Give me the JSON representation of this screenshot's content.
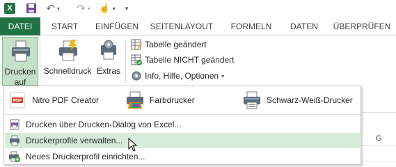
{
  "quick_access": {
    "app_icon_letter": "X"
  },
  "tabs": [
    {
      "label": "DATEI"
    },
    {
      "label": "START"
    },
    {
      "label": "EINFÜGEN"
    },
    {
      "label": "SEITENLAYOUT"
    },
    {
      "label": "FORMELN"
    },
    {
      "label": "DATEN"
    },
    {
      "label": "ÜBERPRÜFEN"
    }
  ],
  "ribbon": {
    "drucken": {
      "line1": "Drucken",
      "line2": "auf"
    },
    "schnelldruck": {
      "label": "Schnelldruck"
    },
    "extras": {
      "label": "Extras"
    },
    "small_buttons": [
      {
        "label": "Tabelle geändert"
      },
      {
        "label": "Tabelle NICHT geändert"
      },
      {
        "label": "Info, Hilfe, Optionen"
      }
    ]
  },
  "menu": {
    "printers": [
      {
        "label": "Nitro PDF Creator",
        "icon": "pdf-printer-icon"
      },
      {
        "label": "Farbdrucker",
        "icon": "color-printer-icon"
      },
      {
        "label": "Schwarz-Weiß-Drucker",
        "icon": "printer-icon"
      }
    ],
    "items": [
      {
        "label": "Drucken über Drucken-Dialog von Excel..."
      },
      {
        "label": "Druckerprofile verwalten..."
      },
      {
        "label": "Neues Druckerprofil einrichten..."
      }
    ]
  },
  "sheet": {
    "column_header": "G"
  },
  "colors": {
    "accent": "#217346",
    "hover": "#d4ecd9",
    "pressed": "#c5e0c9"
  }
}
